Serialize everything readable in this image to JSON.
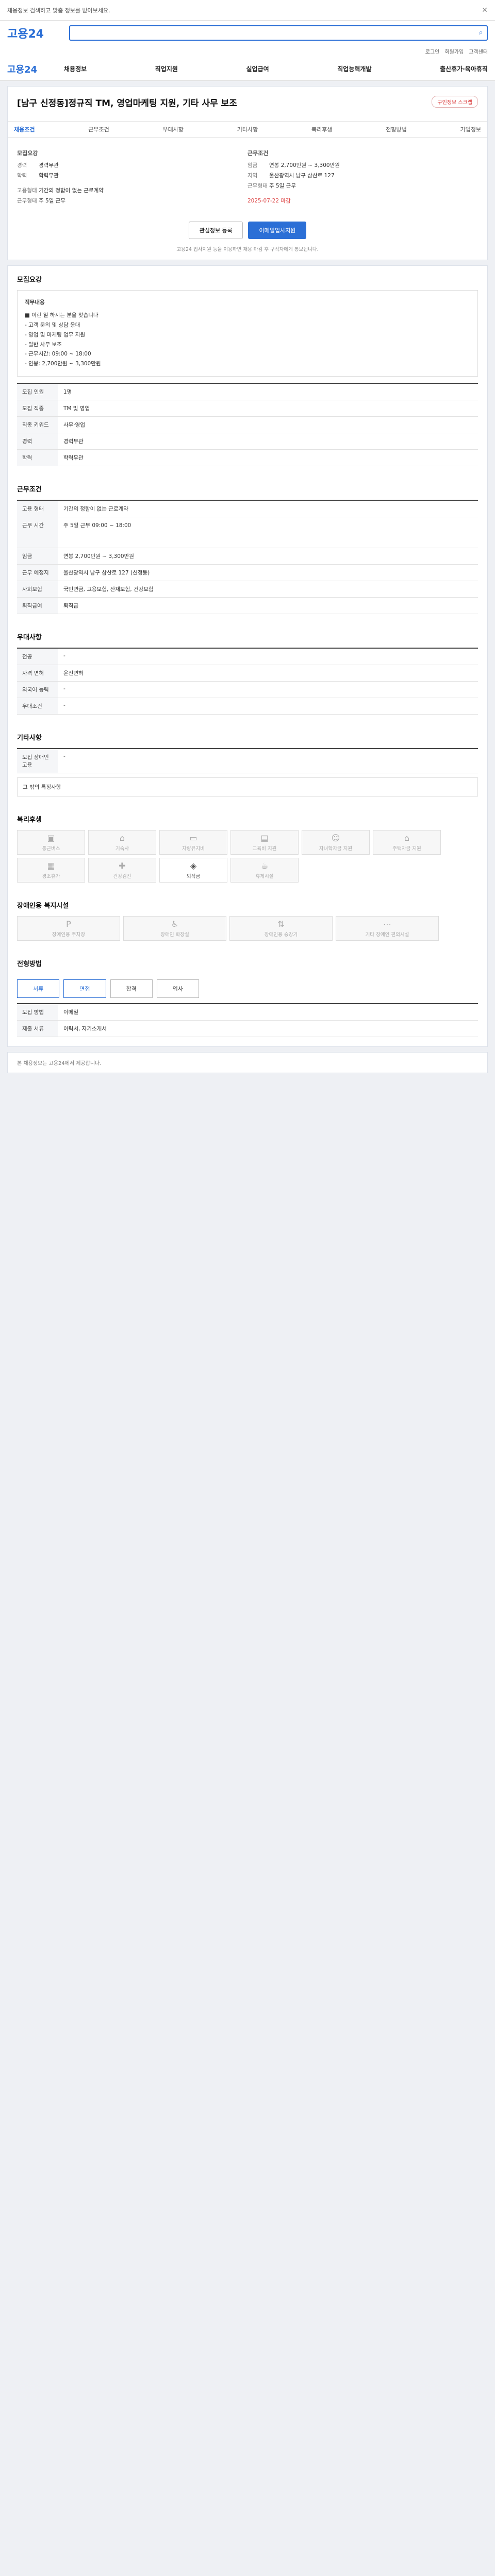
{
  "topbar": {
    "text": "채용정보 검색하고 맞춤 정보를 받아보세요.",
    "close": "✕"
  },
  "brand": {
    "logo": "고용24"
  },
  "utils": [
    "로그인",
    "회원가입",
    "고객센터"
  ],
  "gnb": {
    "logo": "고용24",
    "menu": [
      "채용정보",
      "직업지원",
      "실업급여",
      "직업능력개발",
      "출산휴가·육아휴직"
    ]
  },
  "hero": {
    "title": "[남구 신정동]정규직 TM, 영업마케팅 지원, 기타 사무 보조",
    "chip": "구인정보 스크랩",
    "tabs": [
      "채용조건",
      "근무조건",
      "우대사항",
      "기타사항",
      "복리후생",
      "전형방법",
      "기업정보"
    ],
    "left_h": "모집요강",
    "right_h": "근무조건",
    "kv_left": [
      [
        "경력",
        "경력무관"
      ],
      [
        "학력",
        "학력무관"
      ]
    ],
    "kv_right": [
      [
        "임금",
        "연봉 2,700만원 ~ 3,300만원"
      ],
      [
        "지역",
        "울산광역시 남구 삼산로 127"
      ],
      [
        "근무형태",
        "주 5일 근무"
      ]
    ],
    "kv_left2": [
      [
        "고용형태",
        "기간의 정함이 없는 근로계약"
      ],
      [
        "근무형태",
        "주 5일 근무"
      ]
    ],
    "deadline": "2025-07-22 마감",
    "btn_apply": "이메일입사지원",
    "btn_save": "관심정보 등록",
    "note": "고용24 입사지원 등을 이용하면 채용 마감 후 구직자에게 통보됩니다."
  },
  "sections": {
    "recruit": "모집요강",
    "work": "근무조건",
    "pref": "우대사항",
    "etc": "기타사항",
    "welfare": "복리후생",
    "disab": "장애인용 복지시설",
    "process": "전형방법",
    "company": "기업정보"
  },
  "recruit": {
    "job_label": "직무내용",
    "job_text": "■ 이런 일 하시는 분을 찾습니다\n- 고객 문의 및 상담 응대\n- 영업 및 마케팅 업무 지원\n- 일반 사무 보조\n- 근무시간: 09:00 ~ 18:00\n- 연봉: 2,700만원 ~ 3,300만원",
    "rows": [
      [
        "모집 인원",
        "1명"
      ],
      [
        "모집 직종",
        "TM 및 영업"
      ],
      [
        "직종 키워드",
        "사무·영업"
      ],
      [
        "경력",
        "경력무관"
      ],
      [
        "학력",
        "학력무관"
      ]
    ]
  },
  "work": {
    "rows": [
      [
        "고용 형태",
        "기간의 정함이 없는 근로계약"
      ],
      [
        "근무 시간",
        "주 5일 근무 09:00 ~ 18:00"
      ],
      [
        "임금",
        "연봉 2,700만원 ~ 3,300만원"
      ],
      [
        "근무 예정지",
        "울산광역시 남구 삼산로 127 (신정동)"
      ],
      [
        "사회보험",
        "국민연금, 고용보험, 산재보험, 건강보험"
      ],
      [
        "퇴직급여",
        "퇴직금"
      ]
    ]
  },
  "pref": {
    "rows": [
      [
        "전공",
        "-"
      ],
      [
        "자격 면허",
        "운전면허"
      ],
      [
        "외국어 능력",
        "-"
      ],
      [
        "우대조건",
        "-"
      ]
    ]
  },
  "etc": {
    "rows": [
      [
        "모집 장애인 고용",
        "-"
      ]
    ],
    "text": "그 밖의 특징사항"
  },
  "welfare": [
    "통근버스",
    "기숙사",
    "차량유지비",
    "교육비 지원",
    "자녀학자금 지원",
    "주택자금 지원",
    "경조휴가",
    "건강검진",
    "퇴직금",
    "휴게시설"
  ],
  "disab": [
    "장애인용 주차장",
    "장애인 화장실",
    "장애인용 승강기",
    "기타 장애인 편의시설"
  ],
  "process": {
    "btns": [
      "서류",
      "면접",
      "합격",
      "입사"
    ],
    "rows": [
      [
        "모집 방법",
        "이메일"
      ],
      [
        "제출 서류",
        "이력서, 자기소개서"
      ]
    ]
  },
  "foot": "본 채용정보는 고용24에서 제공합니다."
}
